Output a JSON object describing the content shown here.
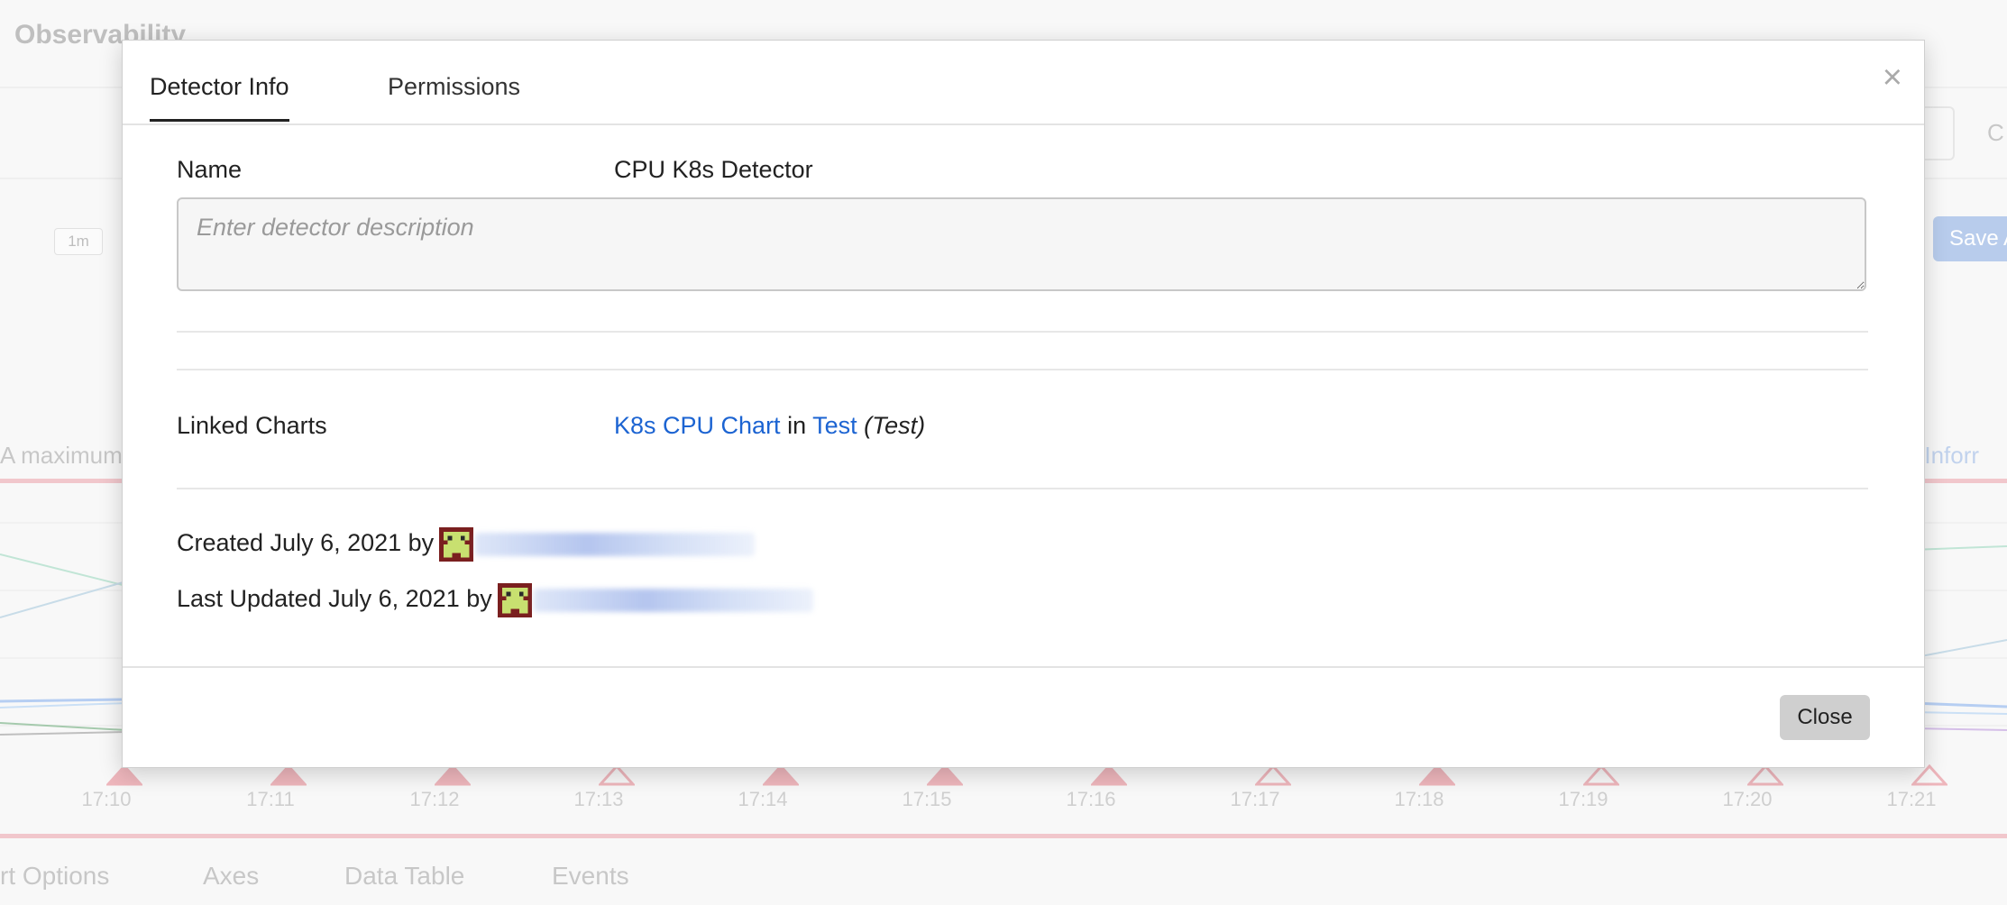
{
  "background": {
    "app_title": "Observability",
    "resolution": "1m",
    "save_button_label": "Save A",
    "right_partial_letter": "C",
    "truncated_left_text": "A maximum",
    "truncated_right_text": "re Inforr",
    "time_ticks": [
      {
        "label": "17:10",
        "filled": true
      },
      {
        "label": "17:11",
        "filled": true
      },
      {
        "label": "17:12",
        "filled": true
      },
      {
        "label": "17:13",
        "filled": false
      },
      {
        "label": "17:14",
        "filled": true
      },
      {
        "label": "17:15",
        "filled": true
      },
      {
        "label": "17:16",
        "filled": true
      },
      {
        "label": "17:17",
        "filled": false
      },
      {
        "label": "17:18",
        "filled": true
      },
      {
        "label": "17:19",
        "filled": false
      },
      {
        "label": "17:20",
        "filled": false
      },
      {
        "label": "17:21",
        "filled": false
      }
    ],
    "marker_color": "#e07a86",
    "bottom_tabs": [
      "rt Options",
      "Axes",
      "Data Table",
      "Events"
    ]
  },
  "modal": {
    "tabs": [
      {
        "label": "Detector Info",
        "active": true
      },
      {
        "label": "Permissions",
        "active": false
      }
    ],
    "close_icon": "close-icon",
    "name_label": "Name",
    "name_value": "CPU K8s Detector",
    "description_placeholder": "Enter detector description",
    "description_value": "",
    "linked_charts_label": "Linked Charts",
    "linked_chart": {
      "chart_name": "K8s CPU Chart",
      "in_word": "in",
      "dashboard_name": "Test",
      "dashboard_group": "(Test)"
    },
    "created_text": "Created July 6, 2021 by",
    "updated_text": "Last Updated July 6, 2021 by",
    "avatar_icon": "user-avatar-icon",
    "link_color": "#1c64d2",
    "close_button_label": "Close"
  }
}
